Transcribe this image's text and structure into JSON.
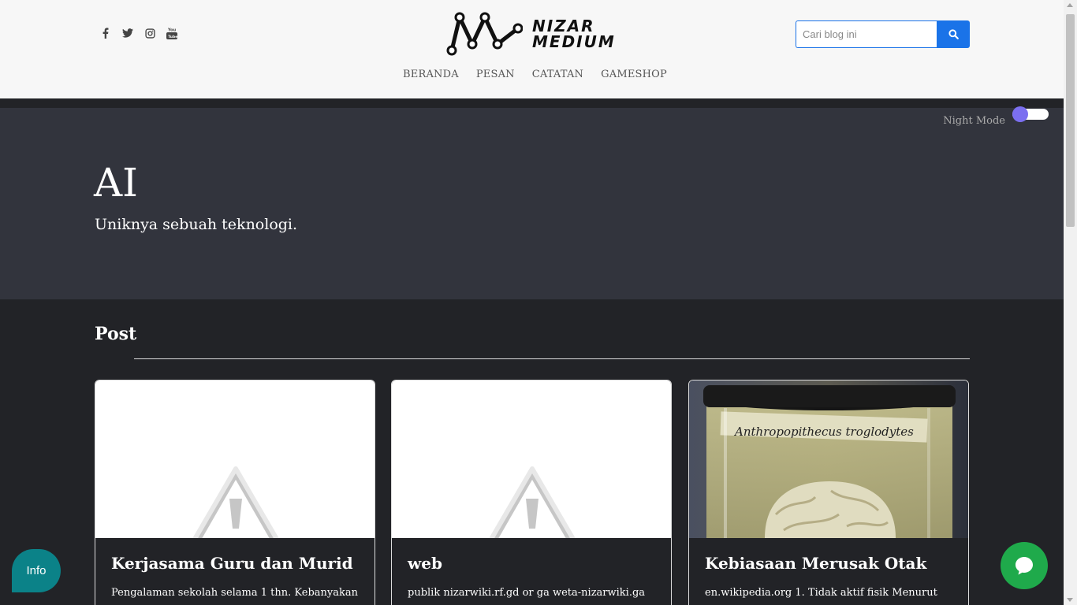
{
  "header": {
    "social": [
      {
        "icon": "facebook-icon",
        "glyph": "f"
      },
      {
        "icon": "twitter-icon",
        "glyph": ""
      },
      {
        "icon": "instagram-icon",
        "glyph": ""
      },
      {
        "icon": "youtube-icon",
        "glyph": ""
      }
    ],
    "logo_line1": "NIZAR",
    "logo_line2": "MEDIUM",
    "search_placeholder": "Cari blog ini",
    "nav": [
      "BERANDA",
      "PESAN",
      "CATATAN",
      "GAMESHOP"
    ]
  },
  "hero": {
    "night_mode_label": "Night Mode",
    "title": "AI",
    "subtitle": "Uniknya sebuah teknologi."
  },
  "posts": {
    "heading": "Post",
    "items": [
      {
        "title": "Kerjasama Guru dan Murid",
        "snippet": "Pengalaman sekolah selama 1 thn. Kebanyakan"
      },
      {
        "title": "web",
        "snippet": "publik nizarwiki.rf.gd or ga weta-nizarwiki.ga"
      },
      {
        "title": "Kebiasaan Merusak Otak",
        "snippet": "en.wikipedia.org 1. Tidak aktif fisik Menurut",
        "image_caption": "Anthropopithecus troglodytes"
      }
    ]
  },
  "widgets": {
    "info_label": "Info"
  },
  "colors": {
    "accent": "#1a73e8",
    "toggle_knob": "#7b6ff0",
    "info_bg": "#0b8288",
    "chat_bg": "#1faa4b",
    "hero_bg": "#32343d",
    "page_bg": "#222327"
  }
}
